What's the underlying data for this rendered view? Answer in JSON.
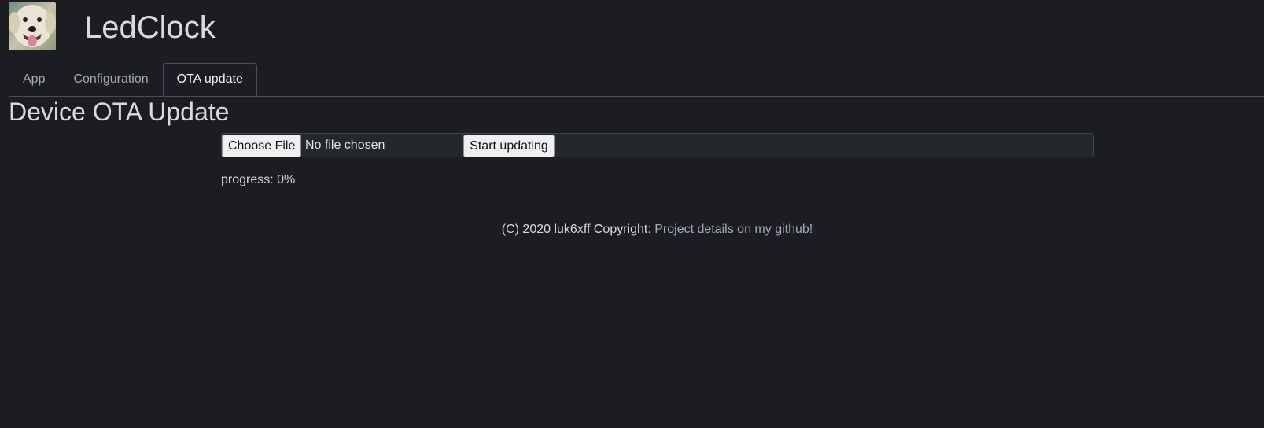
{
  "header": {
    "app_title": "LedClock",
    "logo_icon": "dog-avatar-icon"
  },
  "tabs": [
    {
      "label": "App",
      "active": false
    },
    {
      "label": "Configuration",
      "active": false
    },
    {
      "label": "OTA update",
      "active": true
    }
  ],
  "main": {
    "title": "Device OTA Update",
    "choose_file_label": "Choose File",
    "file_status": "No file chosen",
    "start_button_label": "Start updating",
    "progress_label": "progress: ",
    "progress_value": "0%",
    "progress_fraction": 0
  },
  "footer": {
    "copyright": "(C) 2020 luk6xff Copyright:",
    "link_text": "Project details on my github!"
  },
  "colors": {
    "background": "#1b1d22",
    "text": "#d3d5d8",
    "muted": "#a7abb1",
    "border": "#4a4e55"
  }
}
